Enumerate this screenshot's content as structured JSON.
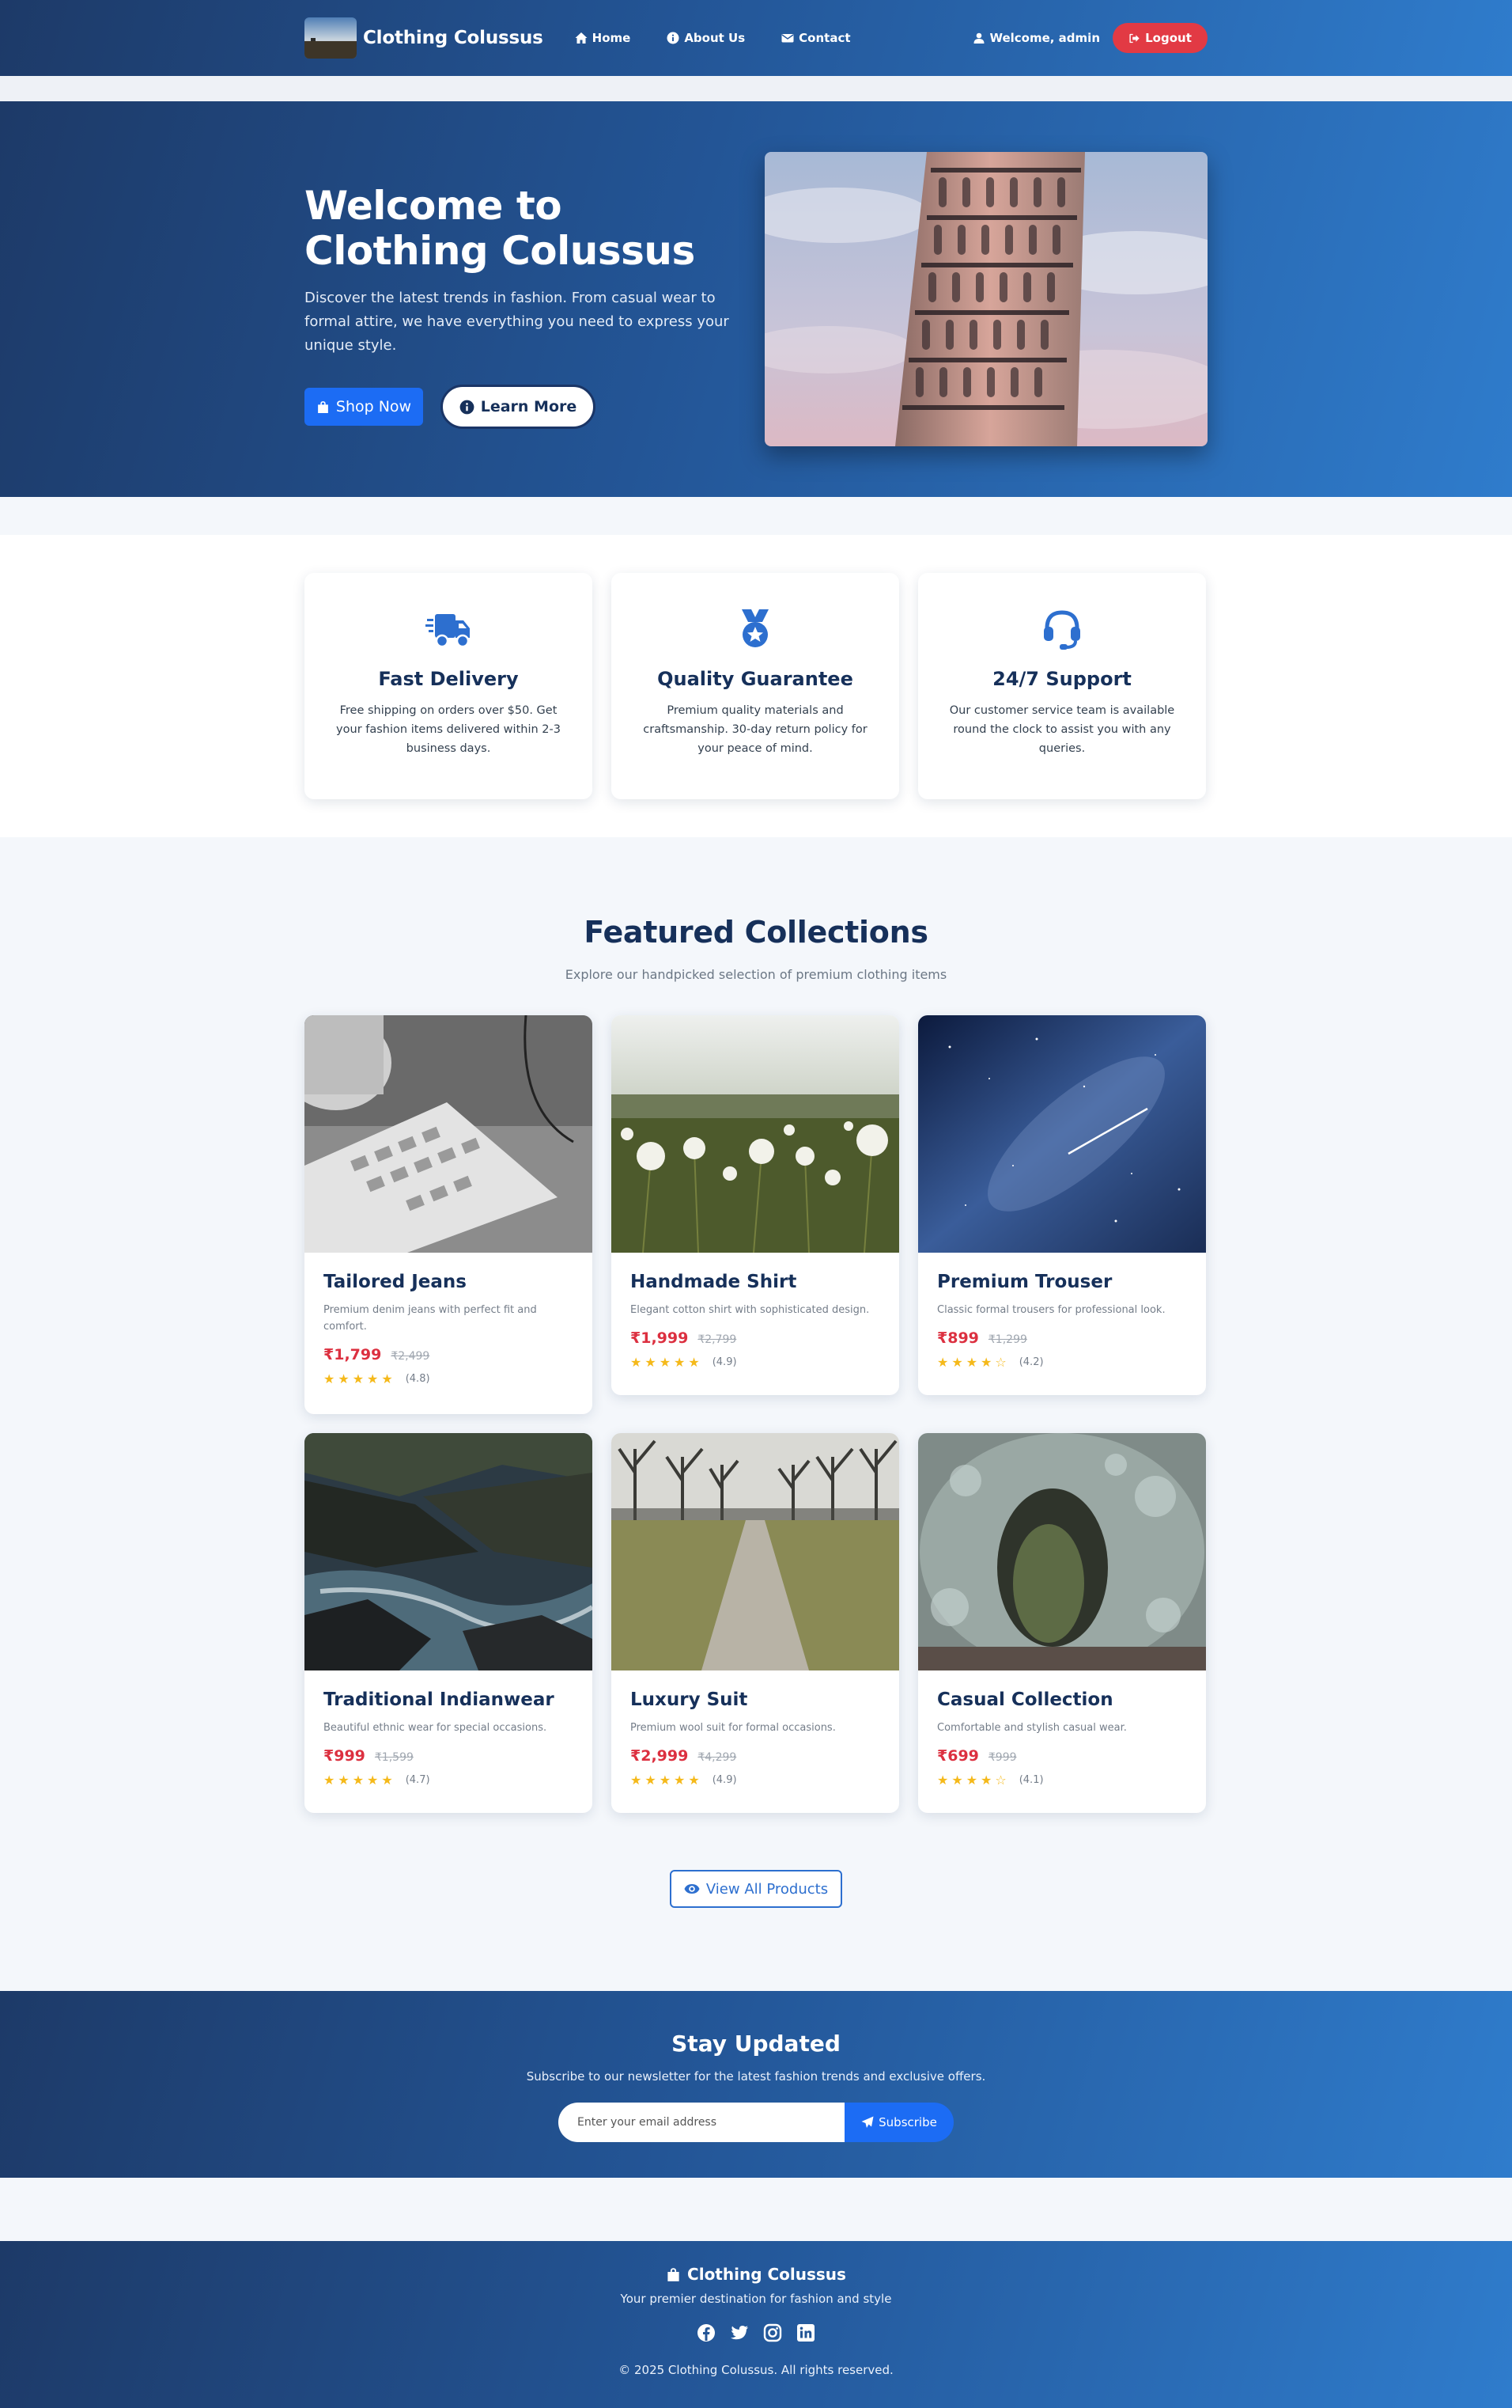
{
  "nav": {
    "brand": "Clothing Colussus",
    "links": [
      "Home",
      "About Us",
      "Contact"
    ],
    "welcome": "Welcome, admin",
    "logout": "Logout"
  },
  "hero": {
    "title": "Welcome to Clothing Colussus",
    "subtitle": "Discover the latest trends in fashion. From casual wear to formal attire, we have everything you need to express your unique style.",
    "shop_now": "Shop Now",
    "learn_more": "Learn More"
  },
  "features": [
    {
      "icon": "truck-icon",
      "title": "Fast Delivery",
      "desc": "Free shipping on orders over $50. Get your fashion items delivered within 2-3 business days."
    },
    {
      "icon": "medal-icon",
      "title": "Quality Guarantee",
      "desc": "Premium quality materials and craftsmanship. 30-day return policy for your peace of mind."
    },
    {
      "icon": "headset-icon",
      "title": "24/7 Support",
      "desc": "Our customer service team is available round the clock to assist you with any queries."
    }
  ],
  "collections": {
    "title": "Featured Collections",
    "subtitle": "Explore our handpicked selection of premium clothing items",
    "products": [
      {
        "name": "Tailored Jeans",
        "desc": "Premium denim jeans with perfect fit and comfort.",
        "price": "₹1,799",
        "old_price": "₹2,499",
        "stars": 5,
        "rating": "(4.8)"
      },
      {
        "name": "Handmade Shirt",
        "desc": "Elegant cotton shirt with sophisticated design.",
        "price": "₹1,999",
        "old_price": "₹2,799",
        "stars": 5,
        "rating": "(4.9)"
      },
      {
        "name": "Premium Trouser",
        "desc": "Classic formal trousers for professional look.",
        "price": "₹899",
        "old_price": "₹1,299",
        "stars": 4,
        "rating": "(4.2)"
      },
      {
        "name": "Traditional Indianwear",
        "desc": "Beautiful ethnic wear for special occasions.",
        "price": "₹999",
        "old_price": "₹1,599",
        "stars": 5,
        "rating": "(4.7)"
      },
      {
        "name": "Luxury Suit",
        "desc": "Premium wool suit for formal occasions.",
        "price": "₹2,999",
        "old_price": "₹4,299",
        "stars": 5,
        "rating": "(4.9)"
      },
      {
        "name": "Casual Collection",
        "desc": "Comfortable and stylish casual wear.",
        "price": "₹699",
        "old_price": "₹999",
        "stars": 4,
        "rating": "(4.1)"
      }
    ],
    "view_all": "View All Products"
  },
  "newsletter": {
    "title": "Stay Updated",
    "text": "Subscribe to our newsletter for the latest fashion trends and exclusive offers.",
    "placeholder": "Enter your email address",
    "button": "Subscribe"
  },
  "footer": {
    "brand": "Clothing Colussus",
    "tagline": "Your premier destination for fashion and style",
    "socials": [
      "facebook-icon",
      "twitter-icon",
      "instagram-icon",
      "linkedin-icon"
    ],
    "copyright": "© 2025 Clothing Colussus. All rights reserved."
  },
  "colors": {
    "primary": "#1c6cf4",
    "accent": "#2d6fcf",
    "danger": "#e23a44",
    "navy": "#16305a",
    "star": "#f5b91a"
  }
}
